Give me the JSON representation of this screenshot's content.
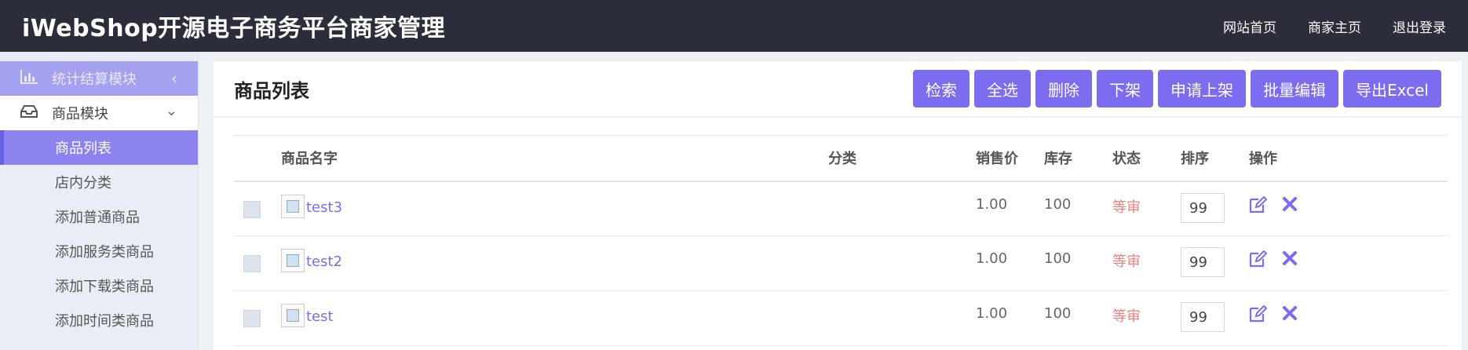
{
  "header": {
    "brand": "iWebShop开源电子商务平台商家管理",
    "nav": [
      "网站首页",
      "商家主页",
      "退出登录"
    ]
  },
  "sidebar": {
    "stat_label": "统计结算模块",
    "goods_label": "商品模块",
    "items": [
      "商品列表",
      "店内分类",
      "添加普通商品",
      "添加服务类商品",
      "添加下载类商品",
      "添加时间类商品"
    ]
  },
  "panel": {
    "title": "商品列表",
    "buttons": [
      "检索",
      "全选",
      "删除",
      "下架",
      "申请上架",
      "批量编辑",
      "导出Excel"
    ]
  },
  "table": {
    "headers": [
      "商品名字",
      "分类",
      "销售价",
      "库存",
      "状态",
      "排序",
      "操作"
    ],
    "rows": [
      {
        "name": "test3",
        "category": "",
        "price": "1.00",
        "stock": "100",
        "status": "等审",
        "sort": "99"
      },
      {
        "name": "test2",
        "category": "",
        "price": "1.00",
        "stock": "100",
        "status": "等审",
        "sort": "99"
      },
      {
        "name": "test",
        "category": "",
        "price": "1.00",
        "stock": "100",
        "status": "等审",
        "sort": "99"
      }
    ]
  },
  "colors": {
    "accent": "#7b6cf0",
    "topbar": "#2b2d3a",
    "status_pending": "#f08080"
  }
}
